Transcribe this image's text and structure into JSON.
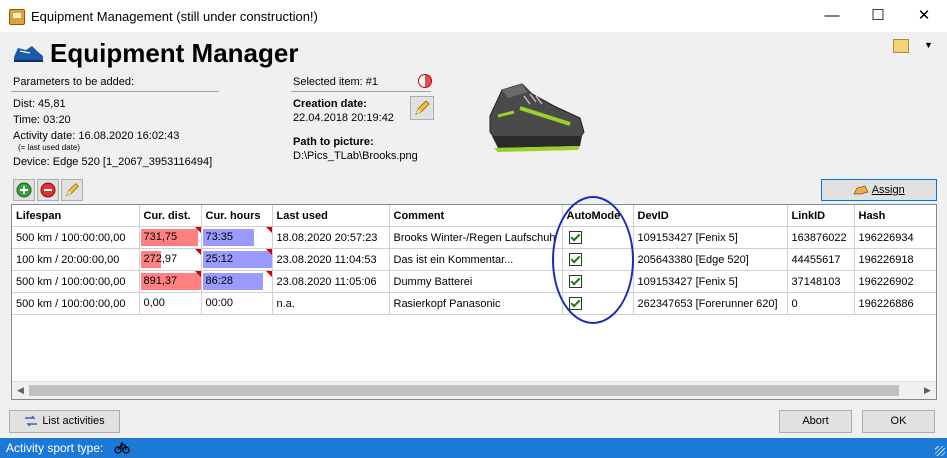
{
  "window": {
    "title": "Equipment Management (still under construction!)",
    "minimize_glyph": "—",
    "maximize_glyph": "☐",
    "close_glyph": "✕"
  },
  "header": {
    "title": "Equipment Manager",
    "toolbar_arrow": "▼"
  },
  "params": {
    "heading": "Parameters to be added:",
    "dist": "Dist: 45,81",
    "time": "Time: 03:20",
    "activity_date": "Activity date: 16.08.2020 16:02:43",
    "last_used_note": "(= last used date)",
    "device": "Device: Edge 520 [1_2067_3953116494]"
  },
  "selected": {
    "label": "Selected item: #1",
    "creation_label": "Creation date:",
    "creation_value": "22.04.2018 20:19:42",
    "path_label": "Path to picture:",
    "path_value": "D:\\Pics_TLab\\Brooks.png"
  },
  "buttons": {
    "assign": "Assign",
    "list_activities": "List activities",
    "abort": "Abort",
    "ok": "OK"
  },
  "table": {
    "columns": [
      "Lifespan",
      "Cur. dist.",
      "Cur. hours",
      "Last used",
      "Comment",
      "AutoMode",
      "DevID",
      "LinkID",
      "Hash"
    ],
    "rows": [
      {
        "lifespan": "500 km / 100:00:00,00",
        "cur_dist": "731,75",
        "dist_fill": 0.95,
        "cur_hours": "73:35",
        "hours_fill": 0.74,
        "last_used": "18.08.2020 20:57:23",
        "comment": "Brooks Winter-/Regen Laufschuh",
        "automode": true,
        "devid": "109153427 [Fenix 5]",
        "linkid": "163876022",
        "hash": "196226934"
      },
      {
        "lifespan": "100 km / 20:00:00,00",
        "cur_dist": "272,97",
        "dist_fill": 0.34,
        "cur_hours": "25:12",
        "hours_fill": 1.0,
        "last_used": "23.08.2020 11:04:53",
        "comment": "Das ist ein Kommentar...",
        "automode": true,
        "devid": "205643380 [Edge 520]",
        "linkid": "44455617",
        "hash": "196226918"
      },
      {
        "lifespan": "500 km / 100:00:00,00",
        "cur_dist": "891,37",
        "dist_fill": 1.0,
        "cur_hours": "86:28",
        "hours_fill": 0.87,
        "last_used": "23.08.2020 11:05:06",
        "comment": "Dummy Batterei",
        "automode": true,
        "devid": "109153427 [Fenix 5]",
        "linkid": "37148103",
        "hash": "196226902"
      },
      {
        "lifespan": "500 km / 100:00:00,00",
        "cur_dist": "0,00",
        "dist_fill": 0,
        "cur_hours": "00:00",
        "hours_fill": 0,
        "last_used": "n.a.",
        "comment": "Rasierkopf Panasonic",
        "automode": true,
        "devid": "262347653 [Forerunner 620]",
        "linkid": "0",
        "hash": "196226886"
      }
    ]
  },
  "status": {
    "text": "Activity sport type:"
  },
  "icons": {
    "app": "app-icon",
    "logo": "shoe-logo-icon",
    "tool": "folder-tool-icon",
    "add": "add-icon",
    "remove": "remove-icon",
    "edit": "pencil-icon",
    "pie": "pie-icon",
    "assign": "assign-icon",
    "list": "list-activities-icon",
    "bike": "bike-icon"
  },
  "colors": {
    "dist_bar": "#ff8080",
    "hours_bar": "#9a9aff",
    "status_bar": "#1c7ad6",
    "annotation": "#1a2db8",
    "overdue_flag": "#d00000"
  }
}
